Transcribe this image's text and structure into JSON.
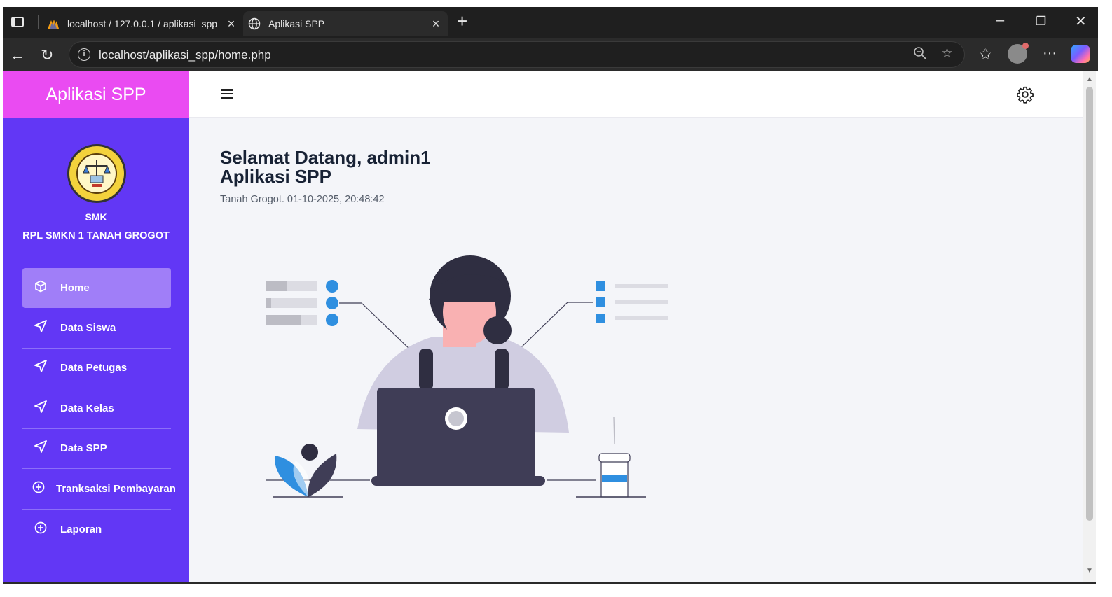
{
  "browser": {
    "tabs": [
      {
        "title": "localhost / 127.0.0.1 / aplikasi_spp",
        "icon": "phpmyadmin-icon"
      },
      {
        "title": "Aplikasi SPP",
        "icon": "globe-icon"
      }
    ],
    "url": "localhost/aplikasi_spp/home.php"
  },
  "sidebar": {
    "brand": "Aplikasi SPP",
    "org_line1": "SMK",
    "org_line2": "RPL SMKN 1 TANAH GROGOT",
    "items": [
      {
        "label": "Home",
        "icon": "cube-icon",
        "active": true
      },
      {
        "label": "Data Siswa",
        "icon": "send-icon"
      },
      {
        "label": "Data Petugas",
        "icon": "send-icon"
      },
      {
        "label": "Data Kelas",
        "icon": "send-icon"
      },
      {
        "label": "Data SPP",
        "icon": "send-icon"
      },
      {
        "label": "Tranksaksi Pembayaran",
        "icon": "plus-circle-icon"
      },
      {
        "label": "Laporan",
        "icon": "plus-circle-icon"
      }
    ]
  },
  "main": {
    "welcome_line1": "Selamat Datang, admin1",
    "welcome_line2": "Aplikasi SPP",
    "location_time": "Tanah Grogot. 01-10-2025, 20:48:42"
  },
  "colors": {
    "sidebar_bg": "#6237f5",
    "brand_bg": "#ea4bf2",
    "active_item_bg": "#a07ef8",
    "illustration_accent": "#2f8fe0"
  }
}
